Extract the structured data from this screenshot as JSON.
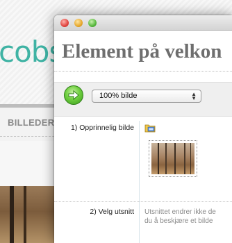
{
  "background_page": {
    "logo_text": "cobse",
    "nav_label": "BILLEDER"
  },
  "window": {
    "heading": "Element på velkon",
    "toolbar": {
      "go_icon": "arrow-right-icon",
      "zoom_select_value": "100% bilde"
    },
    "rows": [
      {
        "label": "1) Opprinnelig bilde",
        "icon": "folder-upload-icon"
      },
      {
        "label": "2) Velg utsnitt",
        "description_line1": "Utsnittet endrer ikke de",
        "description_line2": "du å beskjære et bilde"
      }
    ]
  },
  "colors": {
    "logo": "#3fb3a4",
    "go_button": "#6fcf3f",
    "heading": "#6e6e6e"
  }
}
